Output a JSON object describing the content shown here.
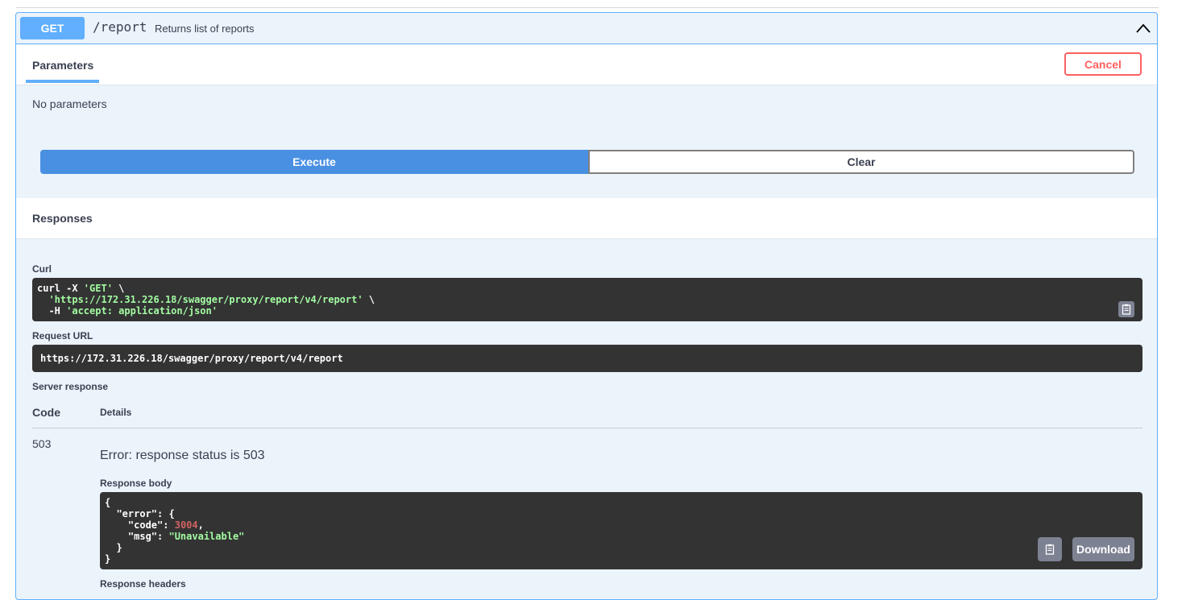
{
  "operation": {
    "method": "GET",
    "path": "/report",
    "description": "Returns list of reports"
  },
  "tabs": {
    "parameters_label": "Parameters",
    "cancel_label": "Cancel"
  },
  "parameters": {
    "empty_text": "No parameters"
  },
  "actions": {
    "execute_label": "Execute",
    "clear_label": "Clear"
  },
  "responses": {
    "title": "Responses",
    "curl_label": "Curl",
    "curl": {
      "line1_cmd": "curl -X ",
      "line1_method": "'GET'",
      "line1_tail": " \\",
      "line2_url": "'https://172.31.226.18/swagger/proxy/report/v4/report'",
      "line2_tail": " \\",
      "line3_flag": "  -H ",
      "line3_header": "'accept: application/json'"
    },
    "request_url_label": "Request URL",
    "request_url": "https://172.31.226.18/swagger/proxy/report/v4/report",
    "server_response_label": "Server response",
    "code_header": "Code",
    "details_header": "Details",
    "status_code": "503",
    "error_text": "Error: response status is 503",
    "response_body_label": "Response body",
    "body": {
      "error_key": "\"error\"",
      "code_key": "\"code\"",
      "code_value": "3004",
      "msg_key": "\"msg\"",
      "msg_value": "\"Unavailable\""
    },
    "download_label": "Download",
    "response_headers_label": "Response headers"
  },
  "colors": {
    "get_method": "#61affe",
    "execute": "#4990e2",
    "cancel": "#ff6060",
    "code_bg": "#333333"
  },
  "icons": [
    "chevron-up-icon",
    "clipboard-icon"
  ]
}
